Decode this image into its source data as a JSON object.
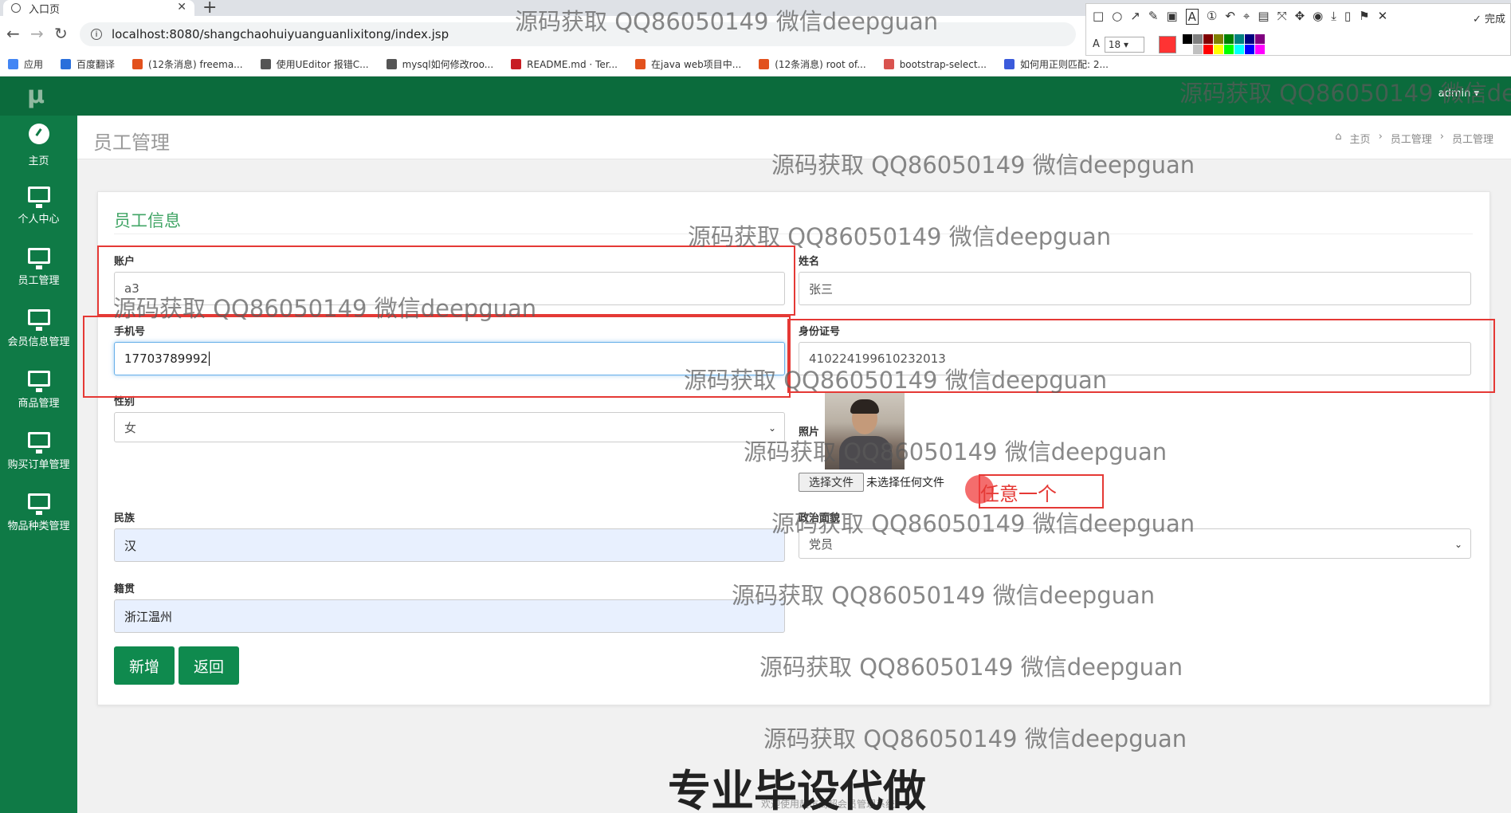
{
  "browser": {
    "tab_title": "入口页",
    "url": "localhost:8080/shangchaohuiyuanguanlixitong/index.jsp",
    "bookmarks": [
      {
        "label": "应用",
        "color": "#4285f4"
      },
      {
        "label": "百度翻译",
        "color": "#2a6fdb"
      },
      {
        "label": "(12条消息) freema...",
        "color": "#e2511d"
      },
      {
        "label": "使用UEditor 报错C...",
        "color": "#555555"
      },
      {
        "label": "mysql如何修改roo...",
        "color": "#555555"
      },
      {
        "label": "README.md · Ter...",
        "color": "#c71d23"
      },
      {
        "label": "在java web项目中...",
        "color": "#e2511d"
      },
      {
        "label": "(12条消息) root of...",
        "color": "#e2511d"
      },
      {
        "label": "bootstrap-select...",
        "color": "#d9534f"
      },
      {
        "label": "如何用正则匹配: 2...",
        "color": "#3b5bdb"
      }
    ]
  },
  "annotation_tool": {
    "font_size": "18",
    "done_label": "完成",
    "text_icon": "A",
    "active_color": "#ff3333",
    "palette": [
      "#000000",
      "#808080",
      "#800000",
      "#808000",
      "#008000",
      "#008080",
      "#000080",
      "#800080",
      "#ffffff",
      "#c0c0c0",
      "#ff0000",
      "#ffff00",
      "#00ff00",
      "#00ffff",
      "#0000ff",
      "#ff00ff"
    ]
  },
  "app": {
    "logo": "μ",
    "user_menu": "admin ▾",
    "sidebar": [
      {
        "label": "主页",
        "icon": "dashboard-icon"
      },
      {
        "label": "个人中心",
        "icon": "monitor-icon"
      },
      {
        "label": "员工管理",
        "icon": "monitor-icon"
      },
      {
        "label": "会员信息管理",
        "icon": "monitor-icon"
      },
      {
        "label": "商品管理",
        "icon": "monitor-icon"
      },
      {
        "label": "购买订单管理",
        "icon": "monitor-icon"
      },
      {
        "label": "物品种类管理",
        "icon": "monitor-icon"
      }
    ],
    "page_title": "员工管理",
    "breadcrumb": [
      "主页",
      "员工管理",
      "员工管理"
    ],
    "footer": "欢迎使用超市商超会员管理系统"
  },
  "form": {
    "title": "员工信息",
    "account_label": "账户",
    "account_value": "a3",
    "name_label": "姓名",
    "name_value": "张三",
    "phone_label": "手机号",
    "phone_value": "17703789992",
    "id_label": "身份证号",
    "id_value": "410224199610232013",
    "gender_label": "性别",
    "gender_value": "女",
    "photo_label": "照片",
    "file_button": "选择文件",
    "file_status": "未选择任何文件",
    "ethnic_label": "民族",
    "ethnic_value": "汉",
    "politics_label": "政治面貌",
    "politics_value": "党员",
    "native_label": "籍贯",
    "native_value": "浙江温州",
    "add_button": "新增",
    "back_button": "返回"
  },
  "annotation_note": "任意一个",
  "watermark_text": "源码获取 QQ86050149 微信deepguan",
  "banner": "专业毕设代做"
}
